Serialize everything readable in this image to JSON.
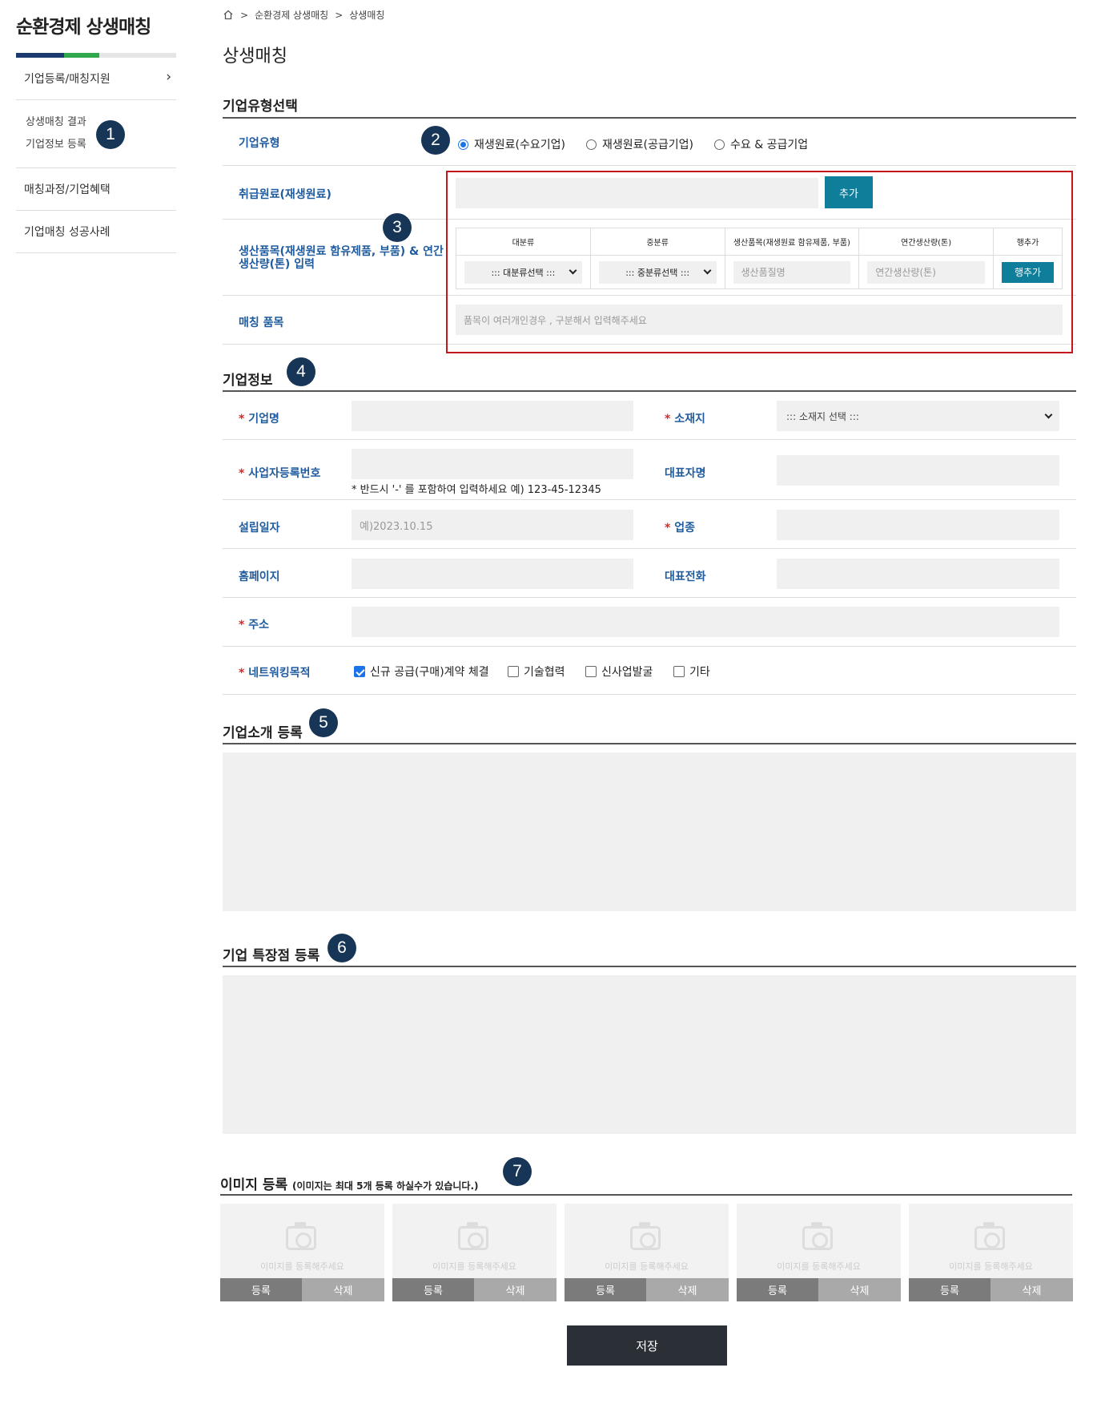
{
  "sidebar": {
    "title": "순환경제 상생매칭",
    "items": [
      {
        "label": "기업등록/매칭지원"
      },
      {
        "label": "상생매칭 결과"
      },
      {
        "label": "기업정보 등록"
      },
      {
        "label": "매칭과정/기업혜택"
      },
      {
        "label": "기업매칭 성공사례"
      }
    ]
  },
  "badges": [
    "1",
    "2",
    "3",
    "4",
    "5",
    "6",
    "7"
  ],
  "breadcrumb": {
    "sep": ">",
    "items": [
      "순환경제 상생매칭",
      "상생매칭"
    ]
  },
  "page_title": "상생매칭",
  "type_section": {
    "title": "기업유형선택",
    "company_type_label": "기업유형",
    "radios": [
      "재생원료(수요기업)",
      "재생원료(공급기업)",
      "수요 & 공급기업"
    ],
    "selected": "재생원료(수요기업)",
    "material_label": "취급원료(재생원료)",
    "material_value": "",
    "add_button": "추가",
    "product_label": "생산품목(재생원료 함유제품, 부품) & 연간생산량(톤) 입력",
    "product_table": {
      "headers": [
        "대분류",
        "중분류",
        "생산품목(재생원료 함유제품, 부품)",
        "연간생산량(톤)",
        "행추가"
      ],
      "major_select": "::: 대분류선택 :::",
      "middle_select": "::: 중분류선택 :::",
      "item_placeholder": "생산품질명",
      "volume_placeholder": "연간생산량(톤)",
      "add_row_button": "행추가"
    },
    "matching_label": "매칭 품목",
    "matching_placeholder": "품목이 여러개인경우 , 구분해서 입력해주세요"
  },
  "company_section": {
    "title": "기업정보",
    "req_mark": "*",
    "name_label": "기업명",
    "location_label": "소재지",
    "location_select": "::: 소재지 선택 :::",
    "biz_no_label": "사업자등록번호",
    "biz_no_note": "* 반드시 '-' 를 포함하여 입력하세요 예) 123-45-12345",
    "ceo_label": "대표자명",
    "founded_label": "설립일자",
    "founded_placeholder": "예)2023.10.15",
    "industry_label": "업종",
    "homepage_label": "홈페이지",
    "phone_label": "대표전화",
    "address_label": "주소",
    "network_label": "네트워킹목적",
    "network_options": [
      {
        "label": "신규 공급(구매)계약 체결",
        "checked": true
      },
      {
        "label": "기술협력",
        "checked": false
      },
      {
        "label": "신사업발굴",
        "checked": false
      },
      {
        "label": "기타",
        "checked": false
      }
    ]
  },
  "intro_section": {
    "title": "기업소개 등록",
    "value": ""
  },
  "feature_section": {
    "title": "기업 특장점 등록",
    "value": ""
  },
  "image_section": {
    "title": "이미지 등록",
    "subtitle": "(이미지는 최대 5개 등록 하실수가 있습니다.)",
    "card_hint": "이미지를 등록해주세요",
    "register_label": "등록",
    "delete_label": "삭제"
  },
  "save_label": "저장",
  "colors": {
    "accent": "#0f7e9b",
    "label": "#1f5b9e",
    "badge": "#173556",
    "highlight": "#c4161c",
    "required": "#d12a2a"
  }
}
